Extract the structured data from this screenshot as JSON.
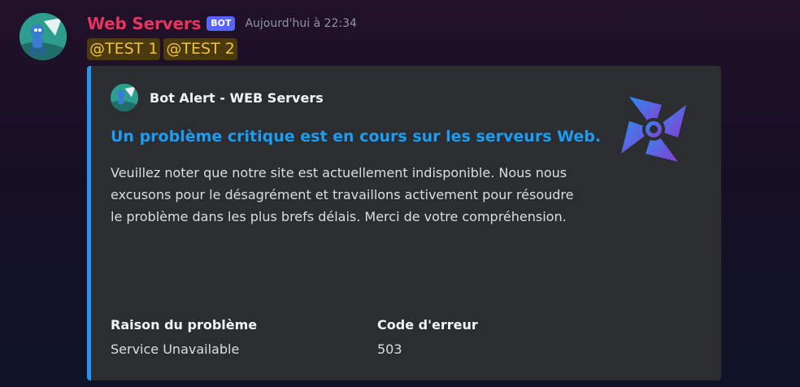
{
  "message": {
    "username": "Web Servers",
    "badge": "BOT",
    "timestamp": "Aujourd'hui à 22:34",
    "mentions": [
      "@TEST 1",
      "@TEST 2"
    ]
  },
  "embed": {
    "accent_color": "#2196f3",
    "author": "Bot Alert - WEB Servers",
    "title": "Un problème critique est en cours sur les serveurs Web.",
    "description": "Veuillez noter que notre site est actuellement indisponible. Nous nous excusons pour le désagrément et travaillons activement pour résoudre le problème dans les plus brefs délais. Merci de votre compréhension.",
    "fields": [
      {
        "name": "Raison du problème",
        "value": "Service Unavailable"
      },
      {
        "name": "Code d'erreur",
        "value": "503"
      }
    ]
  },
  "colors": {
    "username": "#e8335f",
    "badge": "#5865f2",
    "title": "#1e9cf0",
    "mention_text": "#f0c048"
  }
}
